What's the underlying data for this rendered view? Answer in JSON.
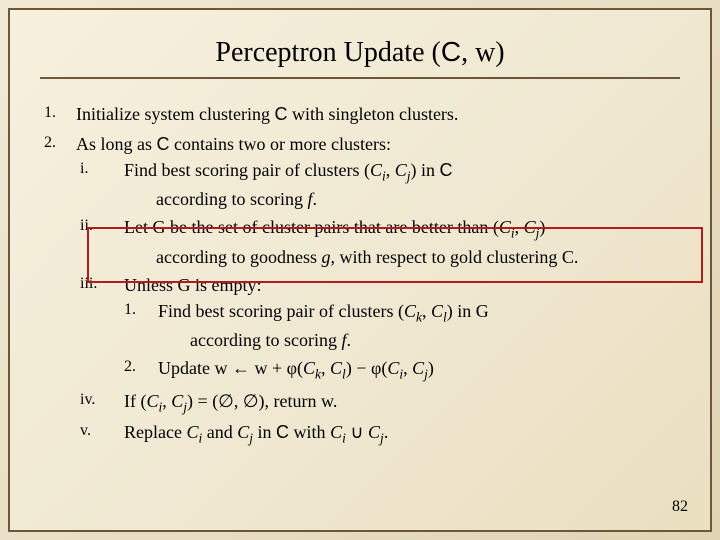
{
  "title_prefix": "Perceptron Update (",
  "title_C": "C",
  "title_suffix": ", w)",
  "items": {
    "n1": "1.",
    "n2": "2.",
    "t1a": "Initialize system clustering ",
    "t1b": " with singleton clusters.",
    "t2a": "As long as ",
    "t2b": " contains two or more clusters:",
    "ri": "i.",
    "rii": "ii.",
    "riii": "iii.",
    "riv": "iv.",
    "rv": "v.",
    "ia": "Find best scoring pair of clusters (",
    "ib": ", ",
    "ic": ") in ",
    "id_line2": "according to scoring f.",
    "iia": "Let G be the set of cluster pairs that are better than (",
    "iib": ", ",
    "iic": ")",
    "iid": "according to goodness g, with respect to gold clustering C.",
    "iiia": "Unless G is empty:",
    "in1": "1.",
    "in2": "2.",
    "iii1a": "Find best scoring pair of clusters (",
    "iii1b": ", ",
    "iii1c": ") in G",
    "iii1d": "according to scoring f.",
    "iii2a": "Update w ← w + φ(",
    "iii2b": ", ",
    "iii2c": ") − φ(",
    "iii2d": ", ",
    "iii2e": ")",
    "iva": "If  (",
    "ivb": ", ",
    "ivc": ") = (∅, ∅), return w.",
    "va": "Replace ",
    "vb": " and ",
    "vc": " in ",
    "vd": " with ",
    "ve": " ∪ ",
    "vf": "."
  },
  "sym": {
    "C": "C",
    "Ci": "C",
    "i": "i",
    "Cj": "C",
    "j": "j",
    "Ck": "C",
    "k": "k",
    "Cl": "C",
    "l": "l"
  },
  "page": "82"
}
